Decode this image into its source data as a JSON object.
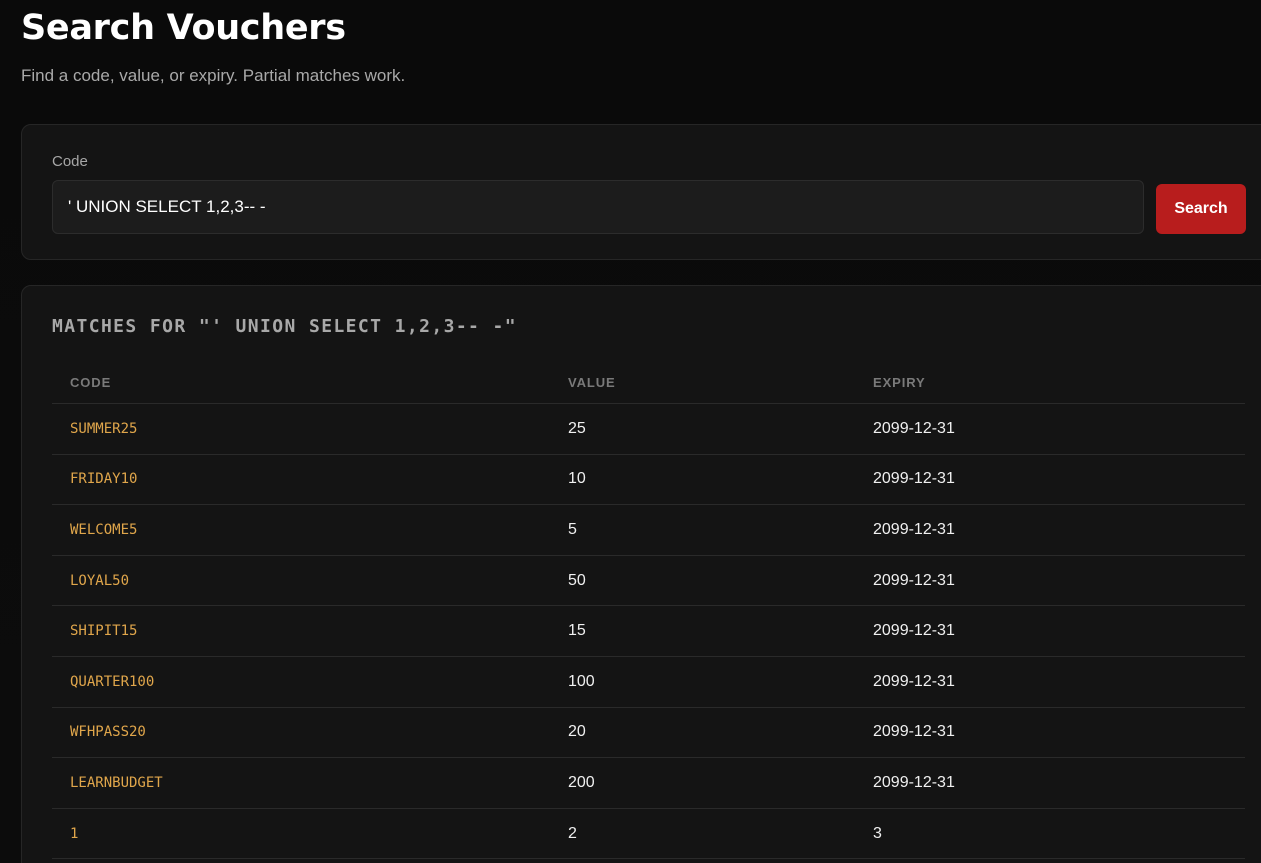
{
  "header": {
    "title": "Search Vouchers",
    "subtitle": "Find a code, value, or expiry. Partial matches work."
  },
  "search": {
    "label": "Code",
    "value": "' UNION SELECT 1,2,3-- -",
    "button_label": "Search"
  },
  "results": {
    "heading": "MATCHES FOR \"' UNION SELECT 1,2,3-- -\"",
    "columns": [
      "CODE",
      "VALUE",
      "EXPIRY"
    ],
    "rows": [
      {
        "code": "SUMMER25",
        "value": "25",
        "expiry": "2099-12-31"
      },
      {
        "code": "FRIDAY10",
        "value": "10",
        "expiry": "2099-12-31"
      },
      {
        "code": "WELCOME5",
        "value": "5",
        "expiry": "2099-12-31"
      },
      {
        "code": "LOYAL50",
        "value": "50",
        "expiry": "2099-12-31"
      },
      {
        "code": "SHIPIT15",
        "value": "15",
        "expiry": "2099-12-31"
      },
      {
        "code": "QUARTER100",
        "value": "100",
        "expiry": "2099-12-31"
      },
      {
        "code": "WFHPASS20",
        "value": "20",
        "expiry": "2099-12-31"
      },
      {
        "code": "LEARNBUDGET",
        "value": "200",
        "expiry": "2099-12-31"
      },
      {
        "code": "1",
        "value": "2",
        "expiry": "3"
      }
    ]
  },
  "colors": {
    "accent": "#b81d1d",
    "code_text": "#e0a64b",
    "background": "#0b0b0b",
    "card": "#141414"
  }
}
